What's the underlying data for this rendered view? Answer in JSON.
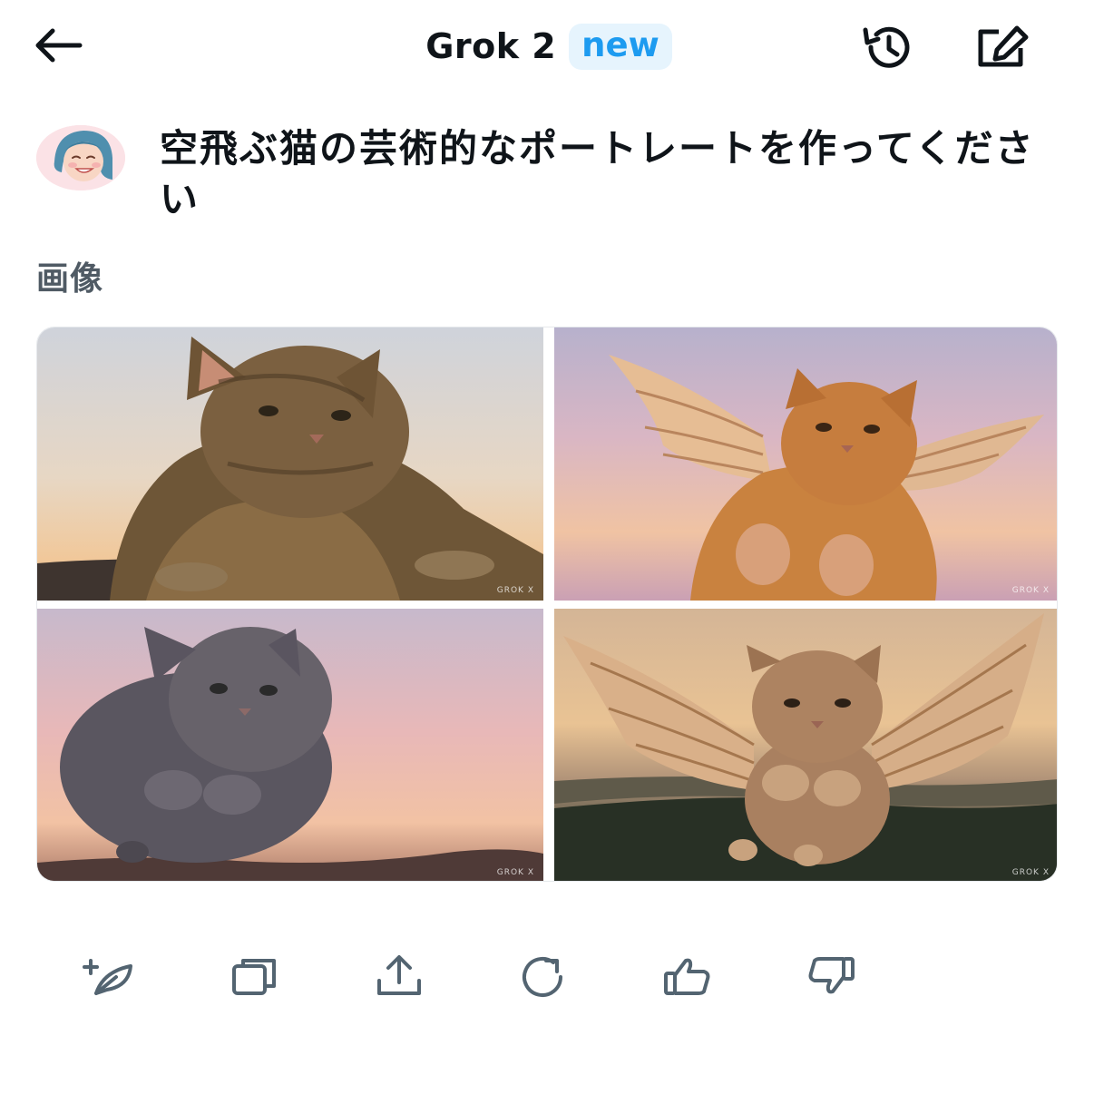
{
  "header": {
    "title": "Grok 2",
    "badge": "new",
    "back_icon": "arrow-left-icon",
    "history_icon": "history-icon",
    "compose_icon": "compose-icon"
  },
  "conversation": {
    "prompt": "空飛ぶ猫の芸術的なポートレートを作ってください",
    "section_label": "画像"
  },
  "images": [
    {
      "description_icon": "tabby-cat-lying-image",
      "watermark": "GROK X"
    },
    {
      "description_icon": "winged-orange-cat-image",
      "watermark": "GROK X"
    },
    {
      "description_icon": "floating-grey-cat-image",
      "watermark": "GROK X"
    },
    {
      "description_icon": "winged-cat-flying-image",
      "watermark": "GROK X"
    }
  ],
  "actions": [
    {
      "icon": "new-quill-icon"
    },
    {
      "icon": "copy-icon"
    },
    {
      "icon": "share-icon"
    },
    {
      "icon": "regenerate-icon"
    },
    {
      "icon": "thumbs-up-icon"
    },
    {
      "icon": "thumbs-down-icon"
    }
  ],
  "colors": {
    "accent": "#1d9bf0",
    "badge_bg": "#e6f4fd",
    "text": "#0f1419",
    "muted": "#4f5a64",
    "icon": "#536471"
  }
}
